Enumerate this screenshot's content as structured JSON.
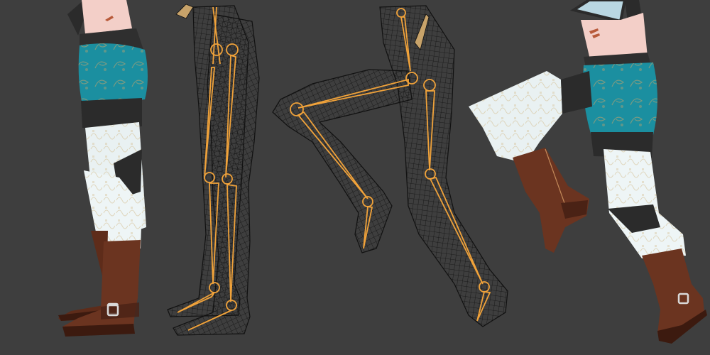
{
  "scene": {
    "background_color": "#3e3e3e",
    "panels": [
      {
        "name": "shaded-legs-standing",
        "view": "shaded"
      },
      {
        "name": "wireframe-legs-standing",
        "view": "wireframe-with-armature"
      },
      {
        "name": "wireframe-legs-kneeling",
        "view": "wireframe-with-armature"
      },
      {
        "name": "shaded-legs-kneeling",
        "view": "shaded"
      }
    ],
    "colors": {
      "skin": "#f3cfc8",
      "shorts_teal": "#1b8fa0",
      "shorts_dark": "#11697a",
      "pattern_gold": "#c8a36a",
      "trim_dark": "#2b2b2b",
      "socks_white": "#e9f1f2",
      "boot_brown": "#6b3420",
      "boot_dark": "#3c1a0f",
      "wire_black": "#111111",
      "bone_orange": "#f0a23a",
      "goggle_blue": "#b9d7e2"
    }
  }
}
